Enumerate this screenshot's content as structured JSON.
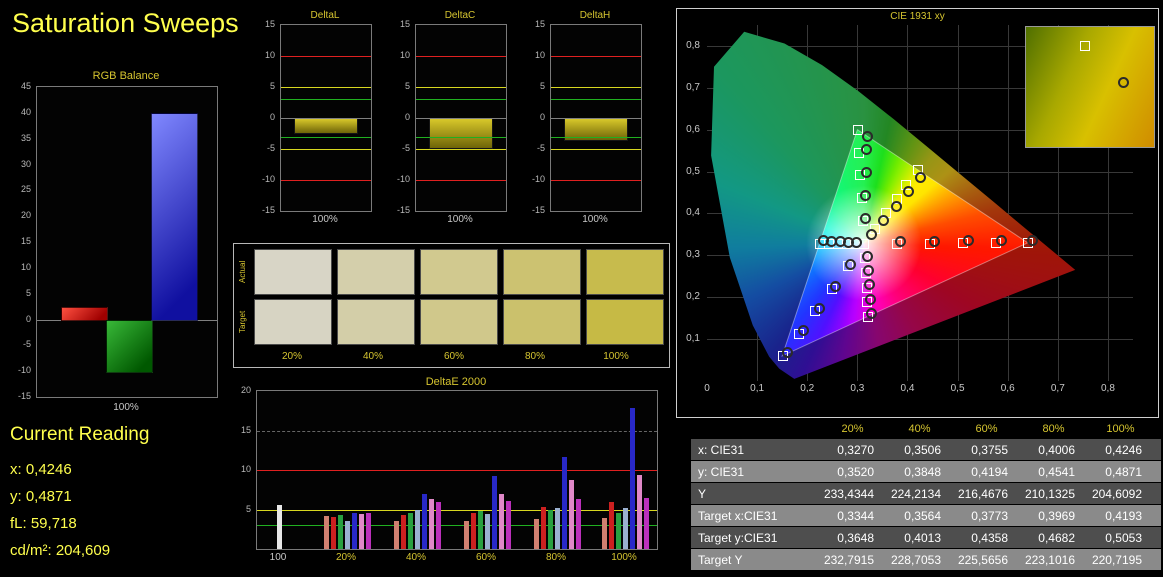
{
  "page": {
    "title": "Saturation Sweeps"
  },
  "colors": {
    "accent": "#ffff4d",
    "chart_title": "#d6c530",
    "ref_red": "#e02020",
    "ref_yellow": "#d8d820",
    "ref_green": "#20b020"
  },
  "chart_data": {
    "rgb_balance": {
      "type": "bar",
      "title": "RGB Balance",
      "ylim": [
        -15,
        45
      ],
      "ytick_step": 5,
      "x_label": "100%",
      "categories": [
        "red",
        "green",
        "blue"
      ],
      "values": [
        2.5,
        -10,
        40
      ],
      "bar_colors": [
        [
          "#ff5040",
          "#a00000"
        ],
        [
          "#38b838",
          "#005800"
        ],
        [
          "#8088ff",
          "#1010a0"
        ]
      ]
    },
    "delta_charts": {
      "type": "bar",
      "ylim": [
        -15,
        15
      ],
      "yticks": [
        15,
        10,
        5,
        0,
        -5,
        -10,
        -15
      ],
      "x_label": "100%",
      "ref_lines": [
        {
          "value": 10,
          "color": "#e02020"
        },
        {
          "value": 5,
          "color": "#d8d820"
        },
        {
          "value": 3,
          "color": "#20b020"
        },
        {
          "value": -3,
          "color": "#20b020"
        },
        {
          "value": -5,
          "color": "#d8d820"
        },
        {
          "value": -10,
          "color": "#e02020"
        }
      ],
      "charts": [
        {
          "title": "DeltaL",
          "value": -2.2
        },
        {
          "title": "DeltaC",
          "value": -4.6
        },
        {
          "title": "DeltaH",
          "value": -3.4
        }
      ]
    },
    "deltae": {
      "type": "bar",
      "title": "DeltaE 2000",
      "ylim": [
        0,
        20
      ],
      "yticks": [
        20,
        15,
        10,
        5
      ],
      "grid_lines": [
        15
      ],
      "ref_lines": [
        {
          "value": 10,
          "color": "#e02020"
        },
        {
          "value": 5,
          "color": "#d8d820"
        },
        {
          "value": 3,
          "color": "#20b020"
        }
      ],
      "groups": [
        {
          "label": "100",
          "label_color": "#c8c8c8",
          "bars": [
            {
              "color": "#e8e8e8",
              "value": 5.6
            }
          ]
        },
        {
          "label": "20%",
          "label_color": "#d6c530",
          "bars": [
            {
              "color": "#d08070",
              "value": 4.2
            },
            {
              "color": "#cc2020",
              "value": 4.0
            },
            {
              "color": "#28a040",
              "value": 4.3
            },
            {
              "color": "#9ab0d0",
              "value": 3.5
            },
            {
              "color": "#2828c8",
              "value": 4.5
            },
            {
              "color": "#e088c8",
              "value": 4.4
            },
            {
              "color": "#bb30bb",
              "value": 4.6
            }
          ]
        },
        {
          "label": "40%",
          "label_color": "#d6c530",
          "bars": [
            {
              "color": "#d08070",
              "value": 3.5
            },
            {
              "color": "#cc2020",
              "value": 4.3
            },
            {
              "color": "#28a040",
              "value": 4.5
            },
            {
              "color": "#9ab0d0",
              "value": 4.9
            },
            {
              "color": "#2828c8",
              "value": 7.0
            },
            {
              "color": "#e088c8",
              "value": 6.3
            },
            {
              "color": "#bb30bb",
              "value": 5.9
            }
          ]
        },
        {
          "label": "60%",
          "label_color": "#d6c530",
          "bars": [
            {
              "color": "#d08070",
              "value": 3.6
            },
            {
              "color": "#cc2020",
              "value": 4.6
            },
            {
              "color": "#28a040",
              "value": 4.8
            },
            {
              "color": "#9ab0d0",
              "value": 4.4
            },
            {
              "color": "#2828c8",
              "value": 9.3
            },
            {
              "color": "#e088c8",
              "value": 7.0
            },
            {
              "color": "#bb30bb",
              "value": 6.1
            }
          ]
        },
        {
          "label": "80%",
          "label_color": "#d6c530",
          "bars": [
            {
              "color": "#d08070",
              "value": 3.8
            },
            {
              "color": "#cc2020",
              "value": 5.3
            },
            {
              "color": "#28a040",
              "value": 5.0
            },
            {
              "color": "#9ab0d0",
              "value": 5.2
            },
            {
              "color": "#2828c8",
              "value": 11.6
            },
            {
              "color": "#e088c8",
              "value": 8.7
            },
            {
              "color": "#bb30bb",
              "value": 6.3
            }
          ]
        },
        {
          "label": "100%",
          "label_color": "#d6c530",
          "bars": [
            {
              "color": "#d08070",
              "value": 3.9
            },
            {
              "color": "#cc2020",
              "value": 6.0
            },
            {
              "color": "#28a040",
              "value": 4.6
            },
            {
              "color": "#9ab0d0",
              "value": 5.2
            },
            {
              "color": "#2828c8",
              "value": 17.9
            },
            {
              "color": "#e088c8",
              "value": 9.4
            },
            {
              "color": "#bb30bb",
              "value": 6.5
            }
          ]
        }
      ]
    },
    "cie": {
      "type": "scatter",
      "title": "CIE 1931 xy",
      "xlim": [
        0,
        0.85
      ],
      "ylim": [
        0,
        0.85
      ],
      "x_ticks": [
        {
          "v": 0,
          "label": "0"
        },
        {
          "v": 0.1,
          "label": "0,1"
        },
        {
          "v": 0.2,
          "label": "0,2"
        },
        {
          "v": 0.3,
          "label": "0,3"
        },
        {
          "v": 0.4,
          "label": "0,4"
        },
        {
          "v": 0.5,
          "label": "0,5"
        },
        {
          "v": 0.6,
          "label": "0,6"
        },
        {
          "v": 0.7,
          "label": "0,7"
        },
        {
          "v": 0.8,
          "label": "0,8"
        }
      ],
      "y_ticks": [
        {
          "v": 0.1,
          "label": "0,1"
        },
        {
          "v": 0.2,
          "label": "0,2"
        },
        {
          "v": 0.3,
          "label": "0,3"
        },
        {
          "v": 0.4,
          "label": "0,4"
        },
        {
          "v": 0.5,
          "label": "0,5"
        },
        {
          "v": 0.6,
          "label": "0,6"
        },
        {
          "v": 0.7,
          "label": "0,7"
        },
        {
          "v": 0.8,
          "label": "0,8"
        }
      ],
      "target_points": [
        [
          0.3127,
          0.329
        ],
        [
          0.378,
          0.329
        ],
        [
          0.444,
          0.329
        ],
        [
          0.509,
          0.33
        ],
        [
          0.575,
          0.33
        ],
        [
          0.64,
          0.33
        ],
        [
          0.31,
          0.383
        ],
        [
          0.308,
          0.437
        ],
        [
          0.305,
          0.492
        ],
        [
          0.303,
          0.546
        ],
        [
          0.3,
          0.6
        ],
        [
          0.28,
          0.275
        ],
        [
          0.248,
          0.221
        ],
        [
          0.215,
          0.168
        ],
        [
          0.183,
          0.114
        ],
        [
          0.15,
          0.06
        ],
        [
          0.3344,
          0.3648
        ],
        [
          0.3564,
          0.4013
        ],
        [
          0.3773,
          0.4358
        ],
        [
          0.3969,
          0.4682
        ],
        [
          0.4193,
          0.5053
        ],
        [
          0.295,
          0.329
        ],
        [
          0.278,
          0.329
        ],
        [
          0.26,
          0.329
        ],
        [
          0.243,
          0.329
        ],
        [
          0.225,
          0.329
        ],
        [
          0.314,
          0.294
        ],
        [
          0.316,
          0.259
        ],
        [
          0.318,
          0.224
        ],
        [
          0.319,
          0.189
        ],
        [
          0.321,
          0.154
        ]
      ],
      "measured_points": [
        [
          0.327,
          0.352
        ],
        [
          0.3506,
          0.3848
        ],
        [
          0.3755,
          0.4194
        ],
        [
          0.4006,
          0.4541
        ],
        [
          0.4246,
          0.4871
        ],
        [
          0.385,
          0.335
        ],
        [
          0.452,
          0.336
        ],
        [
          0.52,
          0.337
        ],
        [
          0.585,
          0.338
        ],
        [
          0.648,
          0.338
        ],
        [
          0.315,
          0.39
        ],
        [
          0.315,
          0.445
        ],
        [
          0.316,
          0.5
        ],
        [
          0.317,
          0.555
        ],
        [
          0.318,
          0.585
        ],
        [
          0.285,
          0.28
        ],
        [
          0.255,
          0.228
        ],
        [
          0.222,
          0.175
        ],
        [
          0.19,
          0.122
        ],
        [
          0.158,
          0.07
        ],
        [
          0.297,
          0.333
        ],
        [
          0.281,
          0.334
        ],
        [
          0.264,
          0.335
        ],
        [
          0.247,
          0.336
        ],
        [
          0.23,
          0.337
        ],
        [
          0.318,
          0.3
        ],
        [
          0.32,
          0.266
        ],
        [
          0.322,
          0.232
        ],
        [
          0.324,
          0.198
        ],
        [
          0.326,
          0.164
        ]
      ],
      "inset": {
        "square": [
          0.42,
          0.12
        ],
        "circle": [
          0.72,
          0.42
        ]
      }
    }
  },
  "swatch_table": {
    "rows": [
      {
        "label": "Actual",
        "colors": [
          "#d8d5c6",
          "#d4cfab",
          "#d1c98f",
          "#ccc271",
          "#c7bb4d"
        ]
      },
      {
        "label": "Target",
        "colors": [
          "#d7d4c3",
          "#d3cea8",
          "#d0c88b",
          "#cbc16c",
          "#c6ba45"
        ]
      }
    ],
    "levels": [
      "20%",
      "40%",
      "60%",
      "80%",
      "100%"
    ]
  },
  "current_reading": {
    "title": "Current Reading",
    "lines": [
      "x: 0,4246",
      "y: 0,4871",
      "fL: 59,718",
      "cd/m²: 204,609"
    ]
  },
  "results_table": {
    "header": [
      "20%",
      "40%",
      "60%",
      "80%",
      "100%"
    ],
    "rows": [
      {
        "label": "x: CIE31",
        "values": [
          "0,3270",
          "0,3506",
          "0,3755",
          "0,4006",
          "0,4246"
        ]
      },
      {
        "label": "y: CIE31",
        "values": [
          "0,3520",
          "0,3848",
          "0,4194",
          "0,4541",
          "0,4871"
        ]
      },
      {
        "label": "Y",
        "values": [
          "233,4344",
          "224,2134",
          "216,4676",
          "210,1325",
          "204,6092"
        ]
      },
      {
        "label": "Target x:CIE31",
        "values": [
          "0,3344",
          "0,3564",
          "0,3773",
          "0,3969",
          "0,4193"
        ]
      },
      {
        "label": "Target y:CIE31",
        "values": [
          "0,3648",
          "0,4013",
          "0,4358",
          "0,4682",
          "0,5053"
        ]
      },
      {
        "label": "Target Y",
        "values": [
          "232,7915",
          "228,7053",
          "225,5656",
          "223,1016",
          "220,7195"
        ]
      }
    ]
  }
}
